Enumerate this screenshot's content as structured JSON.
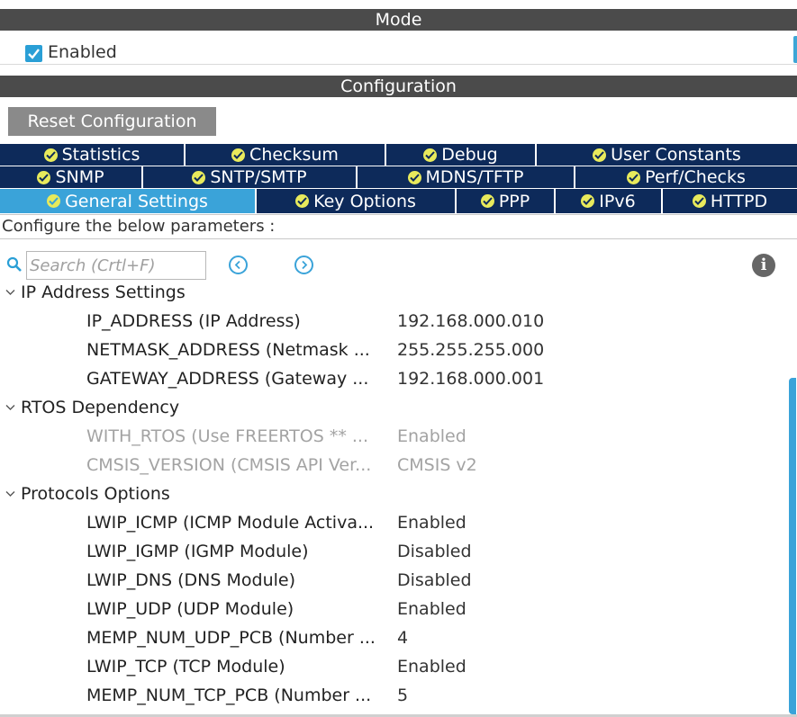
{
  "mode": {
    "title": "Mode",
    "enabled_label": "Enabled",
    "enabled_checked": true
  },
  "configuration": {
    "title": "Configuration",
    "reset_button": "Reset Configuration",
    "tabs_row1": [
      {
        "label": "Statistics",
        "status_icon": "ok-check-icon"
      },
      {
        "label": "Checksum",
        "status_icon": "ok-check-icon"
      },
      {
        "label": "Debug",
        "status_icon": "ok-check-icon"
      },
      {
        "label": "User Constants",
        "status_icon": "ok-check-icon"
      }
    ],
    "tabs_row2": [
      {
        "label": "SNMP",
        "status_icon": "ok-check-icon"
      },
      {
        "label": "SNTP/SMTP",
        "status_icon": "ok-check-icon"
      },
      {
        "label": "MDNS/TFTP",
        "status_icon": "ok-check-icon"
      },
      {
        "label": "Perf/Checks",
        "status_icon": "ok-check-icon"
      }
    ],
    "tabs_row3": [
      {
        "label": "General Settings",
        "status_icon": "ok-check-icon",
        "active": true
      },
      {
        "label": "Key Options",
        "status_icon": "ok-check-icon"
      },
      {
        "label": "PPP",
        "status_icon": "ok-check-icon"
      },
      {
        "label": "IPv6",
        "status_icon": "ok-check-icon"
      },
      {
        "label": "HTTPD",
        "status_icon": "ok-check-icon"
      }
    ],
    "hint": "Configure the below parameters :",
    "search_placeholder": "Search (Crtl+F)"
  },
  "groups": [
    {
      "title": "IP Address Settings",
      "params": [
        {
          "name": "IP_ADDRESS (IP Address)",
          "value": "192.168.000.010",
          "disabled": false
        },
        {
          "name": "NETMASK_ADDRESS (Netmask ...",
          "value": "255.255.255.000",
          "disabled": false
        },
        {
          "name": "GATEWAY_ADDRESS (Gateway ...",
          "value": "192.168.000.001",
          "disabled": false
        }
      ]
    },
    {
      "title": "RTOS Dependency",
      "params": [
        {
          "name": "WITH_RTOS (Use FREERTOS ** ...",
          "value": "Enabled",
          "disabled": true
        },
        {
          "name": "CMSIS_VERSION (CMSIS API Ver...",
          "value": "CMSIS v2",
          "disabled": true
        }
      ]
    },
    {
      "title": "Protocols Options",
      "params": [
        {
          "name": "LWIP_ICMP (ICMP Module Activa...",
          "value": "Enabled",
          "disabled": false
        },
        {
          "name": "LWIP_IGMP (IGMP Module)",
          "value": "Disabled",
          "disabled": false
        },
        {
          "name": "LWIP_DNS (DNS Module)",
          "value": "Disabled",
          "disabled": false
        },
        {
          "name": "LWIP_UDP (UDP Module)",
          "value": "Enabled",
          "disabled": false
        },
        {
          "name": "MEMP_NUM_UDP_PCB (Number ...",
          "value": "4",
          "disabled": false
        },
        {
          "name": "LWIP_TCP (TCP Module)",
          "value": "Enabled",
          "disabled": false
        },
        {
          "name": "MEMP_NUM_TCP_PCB (Number ...",
          "value": "5",
          "disabled": false
        }
      ]
    }
  ],
  "colors": {
    "section_bar": "#4b4b4b",
    "tab_background": "#0d2a5a",
    "tab_active": "#3aa3d9",
    "ok_icon": "#e8ea5c",
    "accent": "#2a9fd6",
    "disabled_text": "#a3a3a3"
  }
}
